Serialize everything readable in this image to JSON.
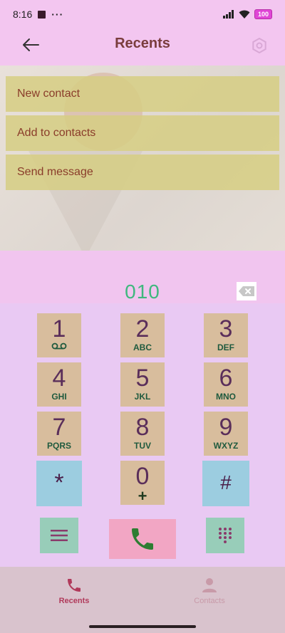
{
  "status_bar": {
    "time": "8:16",
    "more_dots": "···",
    "battery": "100"
  },
  "header": {
    "title": "Recents"
  },
  "menu": {
    "items": [
      {
        "label": "New contact"
      },
      {
        "label": "Add to contacts"
      },
      {
        "label": "Send message"
      }
    ]
  },
  "dialer": {
    "number": "010"
  },
  "keypad": {
    "keys": [
      {
        "digit": "1",
        "letters": ""
      },
      {
        "digit": "2",
        "letters": "ABC"
      },
      {
        "digit": "3",
        "letters": "DEF"
      },
      {
        "digit": "4",
        "letters": "GHI"
      },
      {
        "digit": "5",
        "letters": "JKL"
      },
      {
        "digit": "6",
        "letters": "MNO"
      },
      {
        "digit": "7",
        "letters": "PQRS"
      },
      {
        "digit": "8",
        "letters": "TUV"
      },
      {
        "digit": "9",
        "letters": "WXYZ"
      },
      {
        "digit": "*",
        "letters": ""
      },
      {
        "digit": "0",
        "letters": "+"
      },
      {
        "digit": "#",
        "letters": ""
      }
    ]
  },
  "bottom_nav": {
    "recents_label": "Recents",
    "contacts_label": "Contacts"
  },
  "colors": {
    "accent": "#b13a5b",
    "call": "#2e7d32",
    "number": "#3fb87e"
  }
}
